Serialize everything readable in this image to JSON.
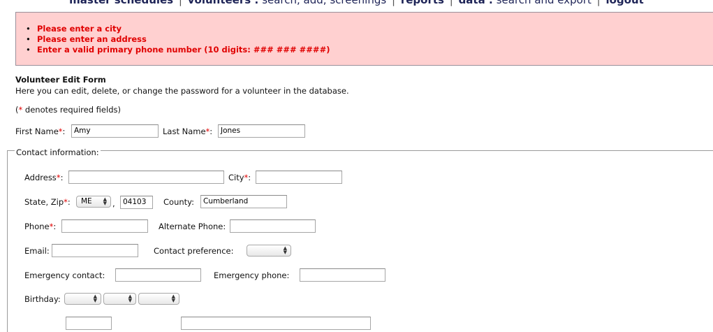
{
  "nav": {
    "master_schedules": "master schedules",
    "volunteers_label": "volunteers :",
    "volunteers_links": "search, add, screenings",
    "reports": "reports",
    "data_label": "data :",
    "data_links": "search and export",
    "logout": "logout",
    "separator": "|"
  },
  "errors": [
    "Please enter a city",
    "Please enter an address",
    "Enter a valid primary phone number (10 digits: ### ### ####)"
  ],
  "form": {
    "title": "Volunteer Edit Form",
    "description": "Here you can edit, delete, or change the password for a volunteer in the database.",
    "required_note_open": "(",
    "required_star": "*",
    "required_note_text": " denotes required fields)"
  },
  "fields": {
    "first_name": {
      "label": "First Name",
      "value": "Amy"
    },
    "last_name": {
      "label": "Last Name",
      "value": "Jones"
    },
    "contact_legend": "Contact information:",
    "address": {
      "label": "Address",
      "value": ""
    },
    "city": {
      "label": "City",
      "value": ""
    },
    "state_zip": {
      "label": "State, Zip",
      "state": "ME",
      "zip": "04103"
    },
    "county": {
      "label": "County:",
      "value": "Cumberland"
    },
    "phone": {
      "label": "Phone",
      "value": ""
    },
    "alt_phone": {
      "label": "Alternate Phone:",
      "value": ""
    },
    "email": {
      "label": "Email:",
      "value": ""
    },
    "contact_pref": {
      "label": "Contact preference:",
      "value": ""
    },
    "emergency_contact": {
      "label": "Emergency contact:",
      "value": ""
    },
    "emergency_phone": {
      "label": "Emergency phone:",
      "value": ""
    },
    "birthday": {
      "label": "Birthday:"
    }
  },
  "punct": {
    "colon": ":",
    "comma": ","
  },
  "colors": {
    "error_bg": "#ffd0d0",
    "error_text": "#e00000",
    "nav_text": "#1e2457"
  }
}
